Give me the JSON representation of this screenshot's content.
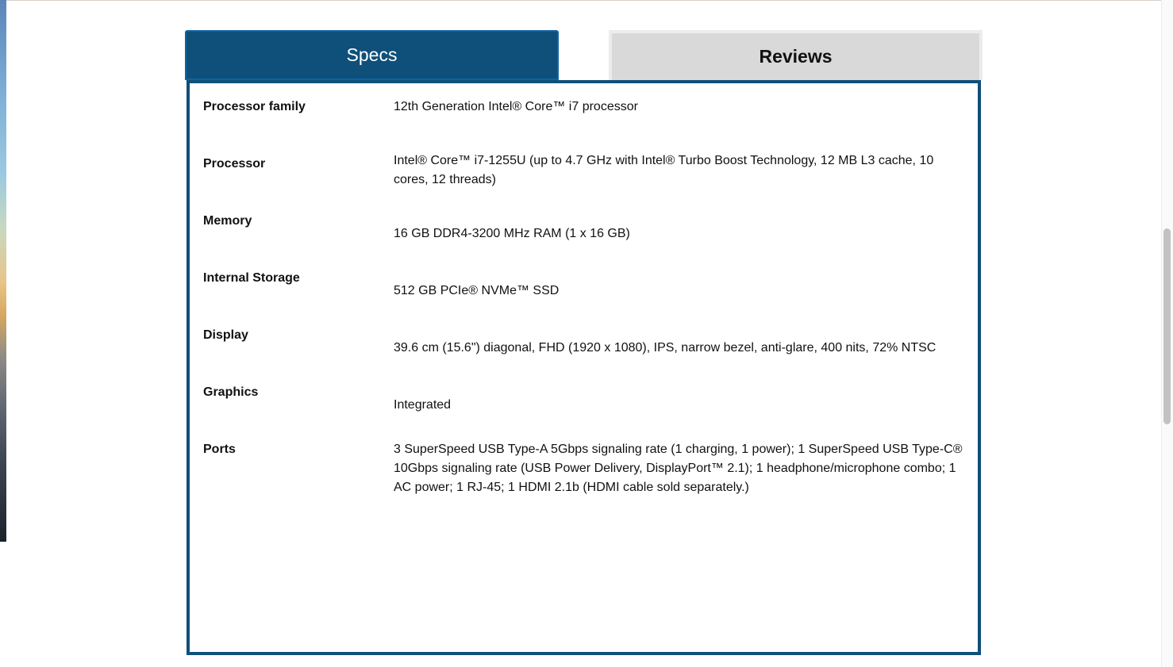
{
  "tabs": {
    "specs_label": "Specs",
    "reviews_label": "Reviews",
    "active": "Specs"
  },
  "specs": [
    {
      "label": "Processor family",
      "value": "12th Generation Intel® Core™ i7 processor"
    },
    {
      "label": "Processor",
      "value": "Intel® Core™ i7-1255U (up to 4.7 GHz with Intel® Turbo Boost Technology, 12 MB L3 cache, 10 cores, 12 threads)"
    },
    {
      "label": "Memory",
      "value": "16 GB DDR4-3200 MHz RAM (1 x 16 GB)"
    },
    {
      "label": "Internal Storage",
      "value": "512 GB PCIe® NVMe™ SSD"
    },
    {
      "label": "Display",
      "value": "39.6 cm (15.6\") diagonal, FHD (1920 x 1080), IPS, narrow bezel, anti-glare, 400 nits, 72% NTSC"
    },
    {
      "label": "Graphics",
      "value": "Integrated"
    },
    {
      "label": "Ports",
      "value": "3 SuperSpeed USB Type-A 5Gbps signaling rate (1 charging, 1 power); 1 SuperSpeed USB Type-C® 10Gbps signaling rate (USB Power Delivery, DisplayPort™ 2.1); 1 headphone/microphone combo; 1 AC power; 1 RJ-45; 1 HDMI 2.1b (HDMI cable sold separately.)"
    }
  ],
  "colors": {
    "active_tab": "#0e5079",
    "inactive_tab": "#d9d9d9",
    "panel_border": "#0e5079"
  }
}
